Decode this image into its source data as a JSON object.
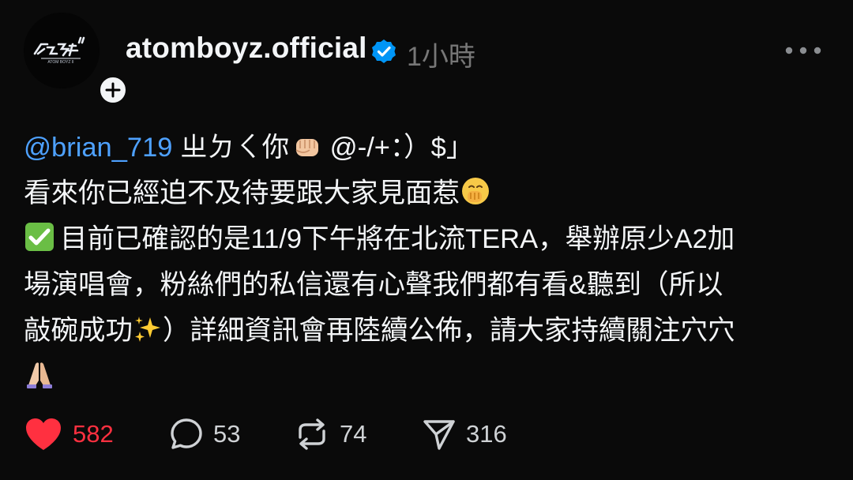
{
  "post": {
    "author": {
      "username": "atomboyz.official",
      "verified_icon": "verified-badge-icon",
      "avatar_logo_text": "原子少年 II",
      "follow_icon": "plus-icon"
    },
    "timestamp": "1小時",
    "more_icon": "more-horizontal-icon",
    "text": {
      "mention": "@brian_719",
      "line1_rest_a": " ㄓㄉㄑ你",
      "line1_rest_b": " @-/+：）$」",
      "line2": "看來你已經迫不及待要跟大家見面惹",
      "line3": "目前已確認的是11/9下午將在北流TERA，舉辦原少A2加",
      "line4": "場演唱會，粉絲們的私信還有心聲我們都有看&聽到（所以",
      "line5_a": "敲碗成功",
      "line5_b": "）詳細資訊會再陸續公佈，請大家持續關注穴穴",
      "emojis": [
        "fist-emoji",
        "face-with-hand-over-mouth-emoji",
        "check-mark-button-emoji",
        "sparkles-emoji",
        "folded-hands-emoji"
      ]
    },
    "actions": {
      "like": {
        "icon": "heart-icon",
        "count": "582",
        "liked": true,
        "color": "#ff3040"
      },
      "comment": {
        "icon": "comment-icon",
        "count": "53"
      },
      "repost": {
        "icon": "repost-icon",
        "count": "74"
      },
      "share": {
        "icon": "send-icon",
        "count": "316"
      }
    }
  },
  "colors": {
    "background": "#0a0a0a",
    "text": "#f3f5f7",
    "secondary": "#777777",
    "mention": "#4ea1ff",
    "verified": "#0095f6",
    "like": "#ff3040"
  }
}
